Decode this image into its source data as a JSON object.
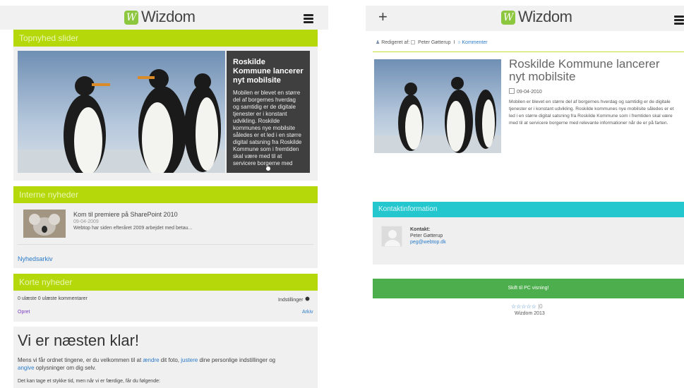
{
  "left": {
    "header": {
      "logo": "Wizdom"
    },
    "slider": {
      "title": "Topnyhed slider",
      "headline": "Roskilde Kommune lancerer nyt mobilsite",
      "body": "Mobilen er blevet en større del af borgernes hverdag og samtidig er de digitale tjenester er i konstant udvikling. Roskilde kommunes nye mobilsite således er et led i en større digital satsning fra Roskilde Kommune som i fremtiden skal være med til at servicere borgerne med"
    },
    "internal_news": {
      "title": "Interne nyheder",
      "item": {
        "title": "Kom til premiere på SharePoint 2010",
        "date": "09-04-2009",
        "excerpt": "Webtop har siden efteråret 2009 arbejdet med betau..."
      },
      "archive_link": "Nyhedsarkiv"
    },
    "short_news": {
      "title": "Korte nyheder",
      "status": "0 ulæste  0 ulæste kommentarer",
      "settings": "Indstillinger",
      "create": "Opret",
      "archive": "Arkiv"
    },
    "welcome": {
      "heading": "Vi er næsten klar!",
      "p1_a": "Mens vi får ordnet tingene, er du velkommen til at ",
      "p1_link1": "ændre",
      "p1_b": " dit foto, ",
      "p1_link2": "justere",
      "p1_c": " dine personlige indstillinger og",
      "p1_link3": "angive",
      "p1_d": " oplysninger om dig selv.",
      "p2": "Det kan tage et stykke tid, men når vi er færdige, får du følgende:"
    }
  },
  "right": {
    "header": {
      "logo": "Wizdom"
    },
    "meta": {
      "edited_by_label": "Redigeret af:",
      "author": "Peter Gøtterup",
      "separator": "I",
      "comments": "Kommenter"
    },
    "article": {
      "title": "Roskilde Kommune lancerer nyt mobilsite",
      "date": "09-04-2010",
      "body": "Mobilen er blevet en større del af borgernes hverdag og samtidig er de digitale tjenester er i konstant udvikling. Roskilde kommunes nye mobilsite således er et led i en større digital satsning fra Roskilde Kommune som i fremtiden skal være med til at servicere borgerne med relevante informationer når de er på farten."
    },
    "contact": {
      "title": "Kontaktinformation",
      "label": "Kontakt:",
      "name": "Peter Gøtterup",
      "email": "peg@webtop.dk"
    },
    "pc_button": "Skift til PC visning!",
    "rating_count": "0",
    "footer": "Wizdom 2013"
  },
  "colors": {
    "green": "#b5d80b",
    "cyan": "#25c7cf",
    "button_green": "#4cae4c",
    "link": "#2b7bc8"
  },
  "icons": [
    "hamburger-icon",
    "plus-icon",
    "gear-icon",
    "user-icon",
    "comment-icon",
    "calendar-icon",
    "star-icon",
    "avatar-icon",
    "slider-dot-icon"
  ]
}
